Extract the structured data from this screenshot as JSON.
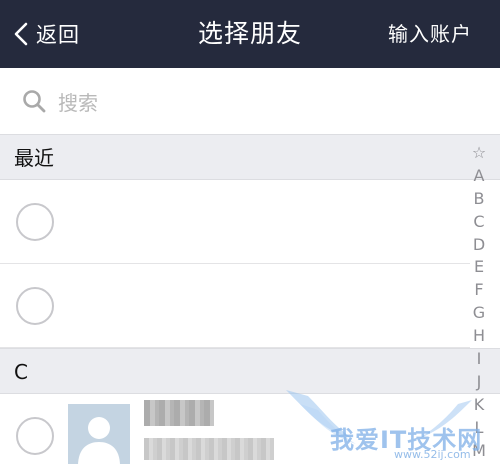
{
  "header": {
    "back_label": "返回",
    "title": "选择朋友",
    "action_label": "输入账户",
    "background": "#252a3d"
  },
  "search": {
    "placeholder": "搜索",
    "icon": "search-icon"
  },
  "sections": [
    {
      "label": "最近",
      "rows": [
        {
          "checked": false
        },
        {
          "checked": false
        }
      ]
    },
    {
      "label": "C",
      "rows": [
        {
          "checked": false,
          "avatar": "default-avatar",
          "name_blurred": true,
          "subtitle_blurred": true
        }
      ]
    }
  ],
  "index_bar": [
    "☆",
    "A",
    "B",
    "C",
    "D",
    "E",
    "F",
    "G",
    "H",
    "I",
    "J",
    "K",
    "L",
    "M"
  ],
  "watermark": {
    "text": "我爱IT技术网",
    "url": "www.52ij.com"
  }
}
